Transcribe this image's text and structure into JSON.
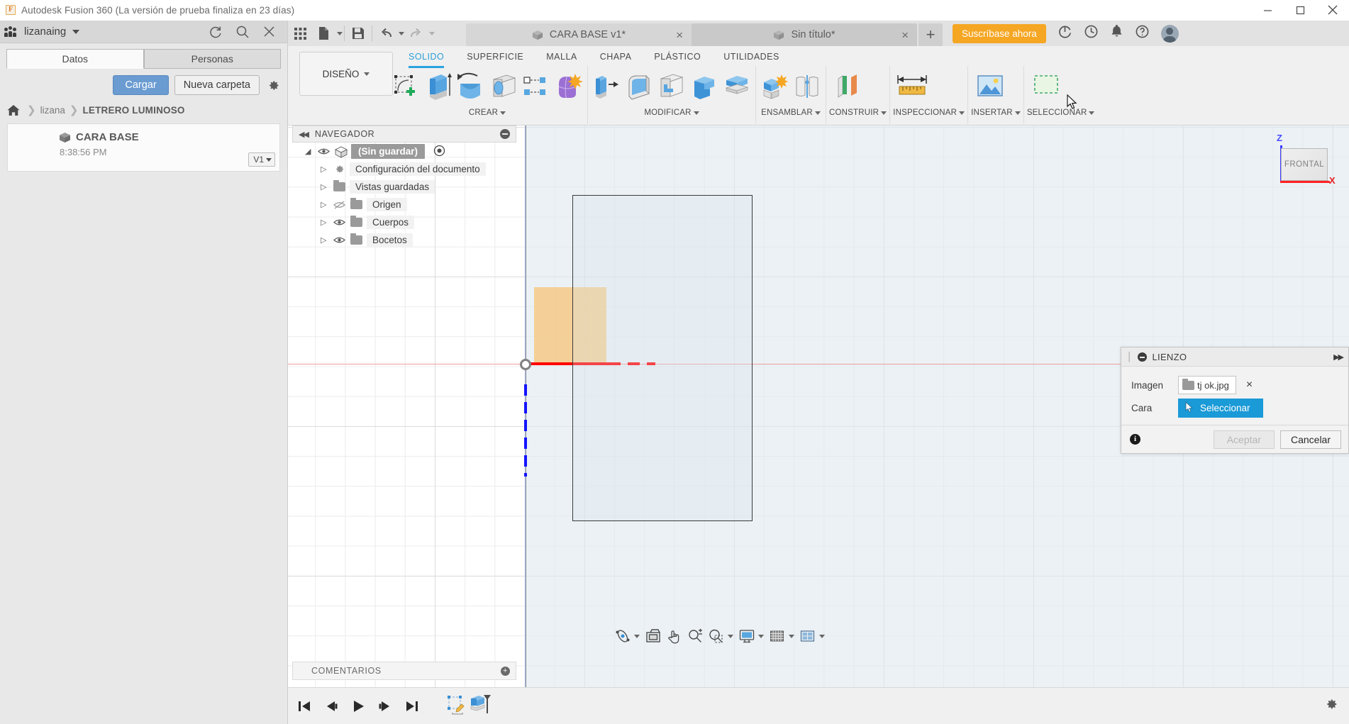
{
  "window": {
    "title": "Autodesk Fusion 360 (La versión de prueba finaliza en 23 días)",
    "app_logo_letter": "F",
    "controls": {
      "minimize": "minimize-icon",
      "maximize": "maximize-icon",
      "close": "close-icon"
    }
  },
  "data_panel": {
    "hub_name": "lizanaing",
    "header_icons": [
      "refresh-icon",
      "search-icon",
      "close-icon"
    ],
    "tabs": [
      {
        "label": "Datos",
        "active": true
      },
      {
        "label": "Personas",
        "active": false
      }
    ],
    "buttons": {
      "upload": "Cargar",
      "new_folder": "Nueva carpeta",
      "settings": "gear-icon"
    },
    "breadcrumb": {
      "home": "home-icon",
      "items": [
        "lizana",
        "LETRERO LUMINOSO"
      ]
    },
    "files": [
      {
        "name": "CARA BASE",
        "time": "8:38:56 PM",
        "version": "V1"
      }
    ]
  },
  "app_toolbar": {
    "icons": [
      "grid-apps-icon",
      "new-file-icon",
      "save-icon",
      "undo-icon",
      "redo-icon"
    ],
    "doc_tabs": [
      {
        "label": "CARA BASE v1*",
        "active": true,
        "close": "×"
      },
      {
        "label": "Sin título*",
        "active": false,
        "close": "×"
      }
    ],
    "new_tab": "+",
    "subscribe_label": "Suscríbase ahora",
    "right_icons": [
      "extensions-icon",
      "job-status-icon",
      "notifications-bell-icon",
      "help-icon",
      "avatar"
    ]
  },
  "ribbon": {
    "workspace_label": "DISEÑO",
    "tabs": [
      {
        "label": "SOLIDO",
        "active": true
      },
      {
        "label": "SUPERFICIE",
        "active": false
      },
      {
        "label": "MALLA",
        "active": false
      },
      {
        "label": "CHAPA",
        "active": false
      },
      {
        "label": "PLÁSTICO",
        "active": false
      },
      {
        "label": "UTILIDADES",
        "active": false
      }
    ],
    "groups": [
      {
        "label": "CREAR",
        "has_caret": true,
        "tools": [
          "create-sketch-icon",
          "extrude-icon",
          "revolve-icon",
          "sweep-icon",
          "pattern-icon",
          "form-icon"
        ]
      },
      {
        "label": "MODIFICAR",
        "has_caret": true,
        "tools": [
          "press-pull-icon",
          "fillet-icon",
          "shell-icon",
          "combine-icon",
          "offset-face-icon"
        ]
      },
      {
        "label": "ENSAMBLAR",
        "has_caret": true,
        "tools": [
          "new-component-icon",
          "joint-icon"
        ]
      },
      {
        "label": "CONSTRUIR",
        "has_caret": true,
        "tools": [
          "offset-plane-icon"
        ]
      },
      {
        "label": "INSPECCIONAR",
        "has_caret": true,
        "tools": [
          "measure-icon"
        ]
      },
      {
        "label": "INSERTAR",
        "has_caret": true,
        "tools": [
          "insert-canvas-icon"
        ]
      },
      {
        "label": "SELECCIONAR",
        "has_caret": true,
        "tools": [
          "selection-filter-icon"
        ]
      }
    ]
  },
  "navigator": {
    "title": "NAVEGADOR",
    "collapse_icon": "collapse-left-icon",
    "options_icon": "panel-options-icon",
    "tree": [
      {
        "label": "(Sin guardar)",
        "icon": "component-cube-icon",
        "eye": "eye-visible-icon",
        "level": 0,
        "selected": true,
        "radio": "display-state-icon"
      },
      {
        "label": "Configuración del documento",
        "icon": "gear-icon",
        "eye": "",
        "level": 1
      },
      {
        "label": "Vistas guardadas",
        "icon": "folder-icon",
        "eye": "",
        "level": 1
      },
      {
        "label": "Origen",
        "icon": "folder-icon",
        "eye": "eye-hidden-icon",
        "level": 1
      },
      {
        "label": "Cuerpos",
        "icon": "folder-icon",
        "eye": "eye-visible-icon",
        "level": 1
      },
      {
        "label": "Bocetos",
        "icon": "folder-icon",
        "eye": "eye-visible-icon",
        "level": 1
      }
    ]
  },
  "comments": {
    "label": "COMENTARIOS",
    "add_icon": "+"
  },
  "view_cube": {
    "face_label": "FRONTAL",
    "z_label": "Z",
    "x_label": "X"
  },
  "lienzo_dialog": {
    "title": "LIENZO",
    "minimize_icon": "collapse-dialog-icon",
    "expand_icon": "expand-right-icon",
    "rows": [
      {
        "label": "Imagen",
        "value": "tj ok.jpg",
        "clear": "×",
        "type": "file"
      },
      {
        "label": "Cara",
        "value": "Seleccionar",
        "type": "select-button"
      }
    ],
    "info_icon": "info-icon",
    "ok_label": "Aceptar",
    "ok_disabled": true,
    "cancel_label": "Cancelar"
  },
  "view_tools": {
    "items": [
      "orbit-icon",
      "look-at-icon",
      "pan-icon",
      "zoom-icon",
      "zoom-window-icon",
      "display-settings-icon",
      "grid-snaps-icon",
      "viewports-icon"
    ]
  },
  "timeline": {
    "buttons": [
      "go-to-start-icon",
      "step-back-icon",
      "play-icon",
      "step-forward-icon",
      "go-to-end-icon"
    ],
    "features": [
      "sketch-feature-icon",
      "extrude-feature-icon"
    ],
    "settings": "settings-gear-icon"
  },
  "colors": {
    "accent_blue": "#29a3e0",
    "primary_button": "#6a9bd1",
    "subscribe_orange": "#f5a623",
    "select_blue": "#1a9ad7",
    "x_axis_red": "#ff0000",
    "z_axis_blue": "#1414ff",
    "canvas_image_tan": "#f7c474",
    "sketch_plane": "#dee9ef"
  }
}
